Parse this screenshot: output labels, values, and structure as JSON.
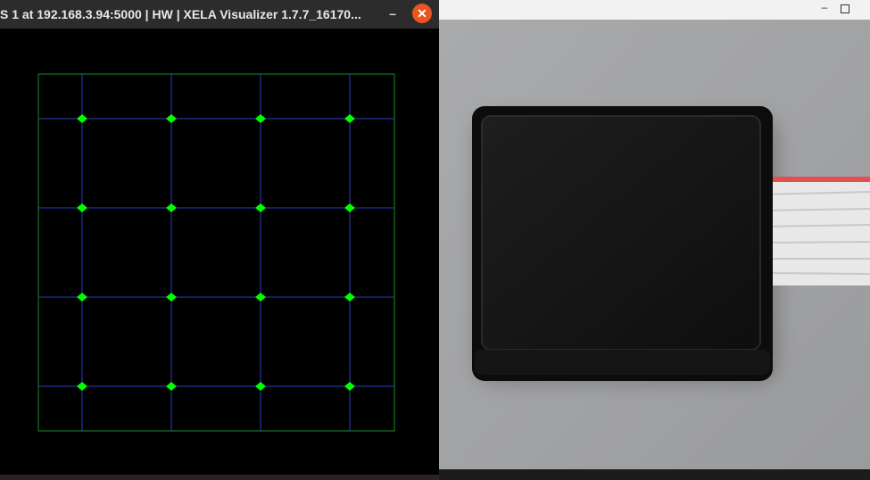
{
  "window_left": {
    "title": "S 1 at 192.168.3.94:5000 | HW | XELA Visualizer 1.7.7_16170...",
    "minimize_glyph": "–",
    "close_glyph": "✕"
  },
  "window_right": {
    "minimize_glyph": "–"
  },
  "sensor_grid": {
    "rows": 4,
    "cols": 4,
    "taxel_color": "#00ff00",
    "grid_line_color": "#2a3fbf",
    "border_color": "#1f8a2a"
  },
  "photo": {
    "background_color": "#9fa0a2",
    "sensor_pad_color": "#141414",
    "cable_color": "#e6e6e6",
    "cable_edge_color": "#e04a4a"
  }
}
